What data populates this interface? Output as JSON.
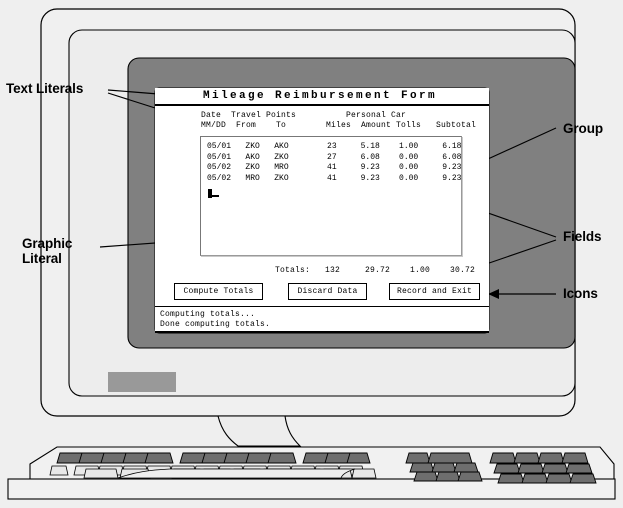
{
  "annotations": {
    "text_literals": "Text Literals",
    "graphic_literal": "Graphic\nLiteral",
    "group": "Group",
    "fields": "Fields",
    "icons": "Icons"
  },
  "terminal": {
    "form_title": "Mileage Reimbursement Form",
    "header_row_1": "Date  Travel Points          Personal Car",
    "header_row_2": "MM/DD  From    To        Miles  Amount Tolls   Subtotal",
    "columns": [
      "Date MM/DD",
      "Travel From",
      "Points To",
      "Miles",
      "Amount",
      "Tolls",
      "Subtotal"
    ],
    "rows": [
      {
        "date": "05/01",
        "from": "ZKO",
        "to": "AKO",
        "miles": "23",
        "amount": "5.18",
        "tolls": "1.00",
        "subtotal": "6.18"
      },
      {
        "date": "05/01",
        "from": "AKO",
        "to": "ZKO",
        "miles": "27",
        "amount": "6.08",
        "tolls": "0.00",
        "subtotal": "6.08"
      },
      {
        "date": "05/02",
        "from": "ZKO",
        "to": "MRO",
        "miles": "41",
        "amount": "9.23",
        "tolls": "0.00",
        "subtotal": "9.23"
      },
      {
        "date": "05/02",
        "from": "MRO",
        "to": "ZKO",
        "miles": "41",
        "amount": "9.23",
        "tolls": "0.00",
        "subtotal": "9.23"
      }
    ],
    "grid_text": "05/01   ZKO   AKO        23     5.18    1.00     6.18\n05/01   AKO   ZKO        27     6.08    0.00     6.08\n05/02   ZKO   MRO        41     9.23    0.00     9.23\n05/02   MRO   ZKO        41     9.23    0.00     9.23",
    "totals": {
      "label": "Totals:",
      "miles": "132",
      "amount": "29.72",
      "tolls": "1.00",
      "subtotal": "30.72",
      "line": "Totals:   132     29.72    1.00    30.72"
    },
    "buttons": {
      "compute": "Compute Totals",
      "discard": "Discard Data",
      "record": "Record and Exit"
    },
    "messages": [
      "Computing totals...",
      "Done computing totals."
    ]
  },
  "colors": {
    "page_background": "#efefef",
    "bezel_outer": "#f0f0f0",
    "bezel_inner": "#ededed",
    "screen_frame": "#808080",
    "screen": "#ffffff",
    "key_dark": "#6e6e6e",
    "key_light": "#e8e8e8",
    "badge": "#999999",
    "outline": "#000000"
  }
}
